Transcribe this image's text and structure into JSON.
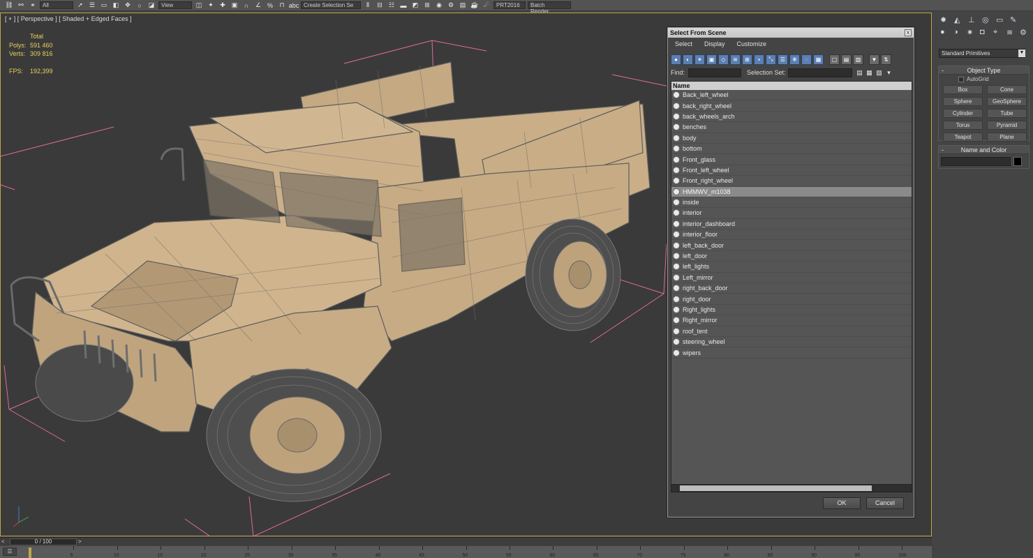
{
  "toolbar": {
    "view_dropdown": "View",
    "selection_set_dropdown": "Create Selection Se",
    "right_labels": [
      "PRT2016",
      "Batch Render..."
    ]
  },
  "viewport": {
    "label": "[ + ] [ Perspective ] [ Shaded + Edged Faces ]",
    "stats": {
      "total_label": "Total",
      "polys_label": "Polys:",
      "polys_value": "591 460",
      "verts_label": "Verts:",
      "verts_value": "309 816",
      "fps_label": "FPS:",
      "fps_value": "192,399"
    }
  },
  "dialog": {
    "title": "Select From Scene",
    "close_glyph": "x",
    "menu": [
      "Select",
      "Display",
      "Customize"
    ],
    "find_label": "Find:",
    "find_value": "",
    "selection_set_label": "Selection Set:",
    "list_header": "Name",
    "items": [
      "Back_left_wheel",
      "back_right_wheel",
      "back_wheels_arch",
      "benches",
      "body",
      "bottom",
      "Front_glass",
      "Front_left_wheel",
      "Front_right_wheel",
      "HMMWV_m1038",
      "inside",
      "interior",
      "interior_dashboard",
      "interior_floor",
      "left_back_door",
      "left_door",
      "left_lights",
      "Left_mirror",
      "right_back_door",
      "right_door",
      "Right_lights",
      "Right_mirror",
      "roof_tent",
      "steering_wheel",
      "wipers"
    ],
    "selected_index": 9,
    "ok_label": "OK",
    "cancel_label": "Cancel"
  },
  "command_panel": {
    "category_dropdown": "Standard Primitives",
    "object_type_title": "Object Type",
    "autogrid_label": "AutoGrid",
    "buttons": [
      "Box",
      "Cone",
      "Sphere",
      "GeoSphere",
      "Cylinder",
      "Tube",
      "Torus",
      "Pyramid",
      "Teapot",
      "Plane"
    ],
    "name_color_title": "Name and Color",
    "name_value": ""
  },
  "timeline": {
    "slider_label": "0 / 100",
    "ticks": [
      "5",
      "10",
      "15",
      "20",
      "25",
      "30",
      "35",
      "40",
      "45",
      "50",
      "55",
      "60",
      "65",
      "70",
      "75",
      "80",
      "85",
      "90",
      "95",
      "100"
    ]
  },
  "colors": {
    "vehicle_fill": "#cdb48e",
    "wire": "#6a6a6a",
    "bounding_lines": "#e06a9e",
    "stats_text": "#e6d25a",
    "viewport_border": "#c2a648"
  }
}
